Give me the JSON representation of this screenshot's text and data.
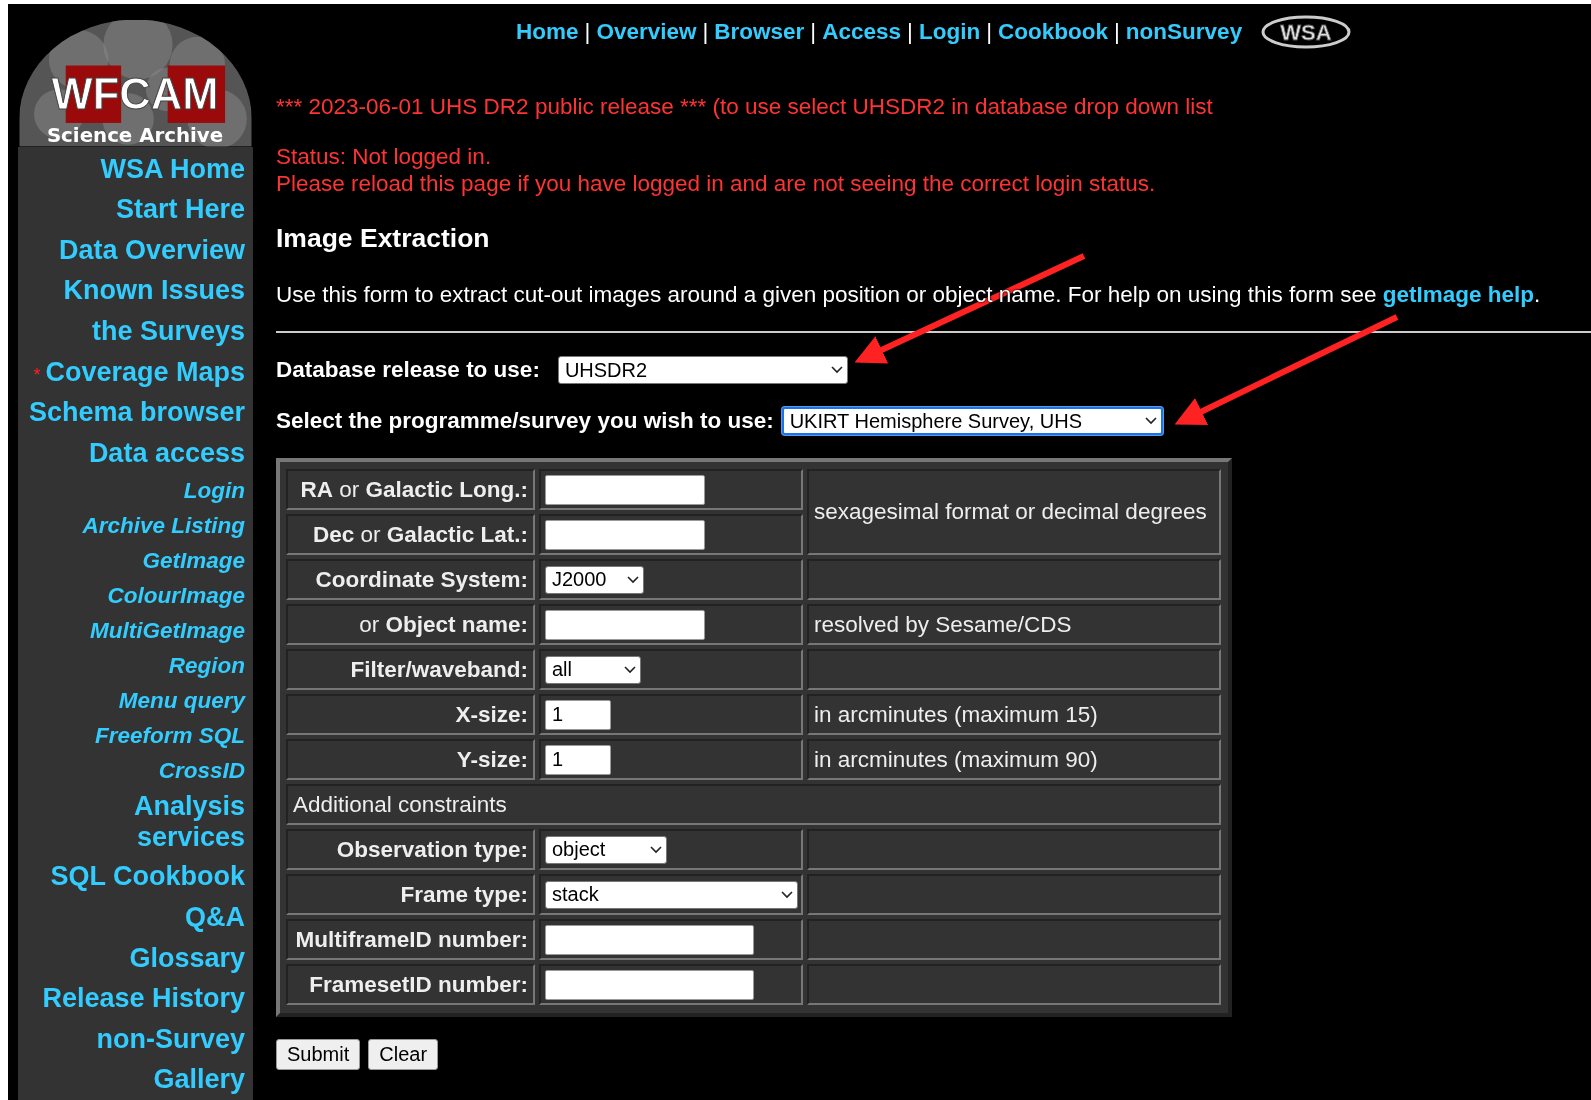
{
  "logo": {
    "title": "WFCAM",
    "subtitle": "Science Archive"
  },
  "sidebar": {
    "items": [
      {
        "label": "WSA Home",
        "kind": "main"
      },
      {
        "label": "Start Here",
        "kind": "main"
      },
      {
        "label": "Data Overview",
        "kind": "main"
      },
      {
        "label": "Known Issues",
        "kind": "main"
      },
      {
        "label": "the Surveys",
        "kind": "main"
      },
      {
        "label": "Coverage Maps",
        "kind": "main",
        "marker": "*"
      },
      {
        "label": "Schema browser",
        "kind": "main"
      },
      {
        "label": "Data access",
        "kind": "main"
      },
      {
        "label": "Login",
        "kind": "sub"
      },
      {
        "label": "Archive Listing",
        "kind": "sub"
      },
      {
        "label": "GetImage",
        "kind": "sub"
      },
      {
        "label": "ColourImage",
        "kind": "sub"
      },
      {
        "label": "MultiGetImage",
        "kind": "sub"
      },
      {
        "label": "Region",
        "kind": "sub"
      },
      {
        "label": "Menu query",
        "kind": "sub"
      },
      {
        "label": "Freeform SQL",
        "kind": "sub"
      },
      {
        "label": "CrossID",
        "kind": "sub"
      },
      {
        "label": "Analysis services",
        "kind": "main"
      },
      {
        "label": "SQL Cookbook",
        "kind": "main"
      },
      {
        "label": "Q&A",
        "kind": "main"
      },
      {
        "label": "Glossary",
        "kind": "main"
      },
      {
        "label": "Release History",
        "kind": "main"
      },
      {
        "label": "non-Survey",
        "kind": "main"
      },
      {
        "label": "Gallery",
        "kind": "main"
      }
    ]
  },
  "nav": {
    "separator": "|",
    "links": [
      "Home",
      "Overview",
      "Browser",
      "Access",
      "Login",
      "Cookbook",
      "nonSurvey"
    ],
    "badge": "WSA"
  },
  "announcement": "*** 2023-06-01 UHS DR2 public release *** (to use select UHSDR2 in database drop down list",
  "status": [
    "Status: Not logged in.",
    "Please reload this page if you have logged in and are not seeing the correct login status."
  ],
  "heading": "Image Extraction",
  "intro": {
    "text": "Use this form to extract cut-out images around a given position or object name. For help on using this form see ",
    "link": "getImage help",
    "end": "."
  },
  "selectors": [
    {
      "label": "Database release to use:",
      "value": "UHSDR2",
      "focused": false
    },
    {
      "label": "Select the programme/survey you wish to use:",
      "value": "UKIRT Hemisphere Survey, UHS",
      "focused": true
    }
  ],
  "form": {
    "rows": [
      {
        "kind": "text",
        "label": "**RA** or **Galactic Long.:**",
        "value": "",
        "hint": "sexagesimal format or decimal degrees"
      },
      {
        "kind": "text",
        "label": "**Dec** or **Galactic Lat.:**",
        "value": ""
      },
      {
        "kind": "select",
        "label": "Coordinate System:",
        "value": "J2000"
      },
      {
        "kind": "text",
        "label": "or **Object name:**",
        "value": "",
        "hint": "resolved by Sesame/CDS"
      },
      {
        "kind": "select",
        "label": "Filter/waveband:",
        "value": "all"
      },
      {
        "kind": "text",
        "label": "X-size:",
        "value": "1",
        "hint": "in arcminutes (maximum 15)"
      },
      {
        "kind": "text",
        "label": "Y-size:",
        "value": "1",
        "hint": "in arcminutes (maximum 90)"
      },
      {
        "kind": "section",
        "label": "Additional constraints"
      },
      {
        "kind": "select",
        "label": "Observation type:",
        "value": "object"
      },
      {
        "kind": "select",
        "label": "Frame type:",
        "value": "stack"
      },
      {
        "kind": "text",
        "label": "MultiframeID number:",
        "value": ""
      },
      {
        "kind": "text",
        "label": "FramesetID number:",
        "value": ""
      }
    ]
  },
  "buttons": [
    "Submit",
    "Clear"
  ],
  "annotations": [
    {
      "kind": "arrow"
    },
    {
      "kind": "arrow"
    }
  ]
}
